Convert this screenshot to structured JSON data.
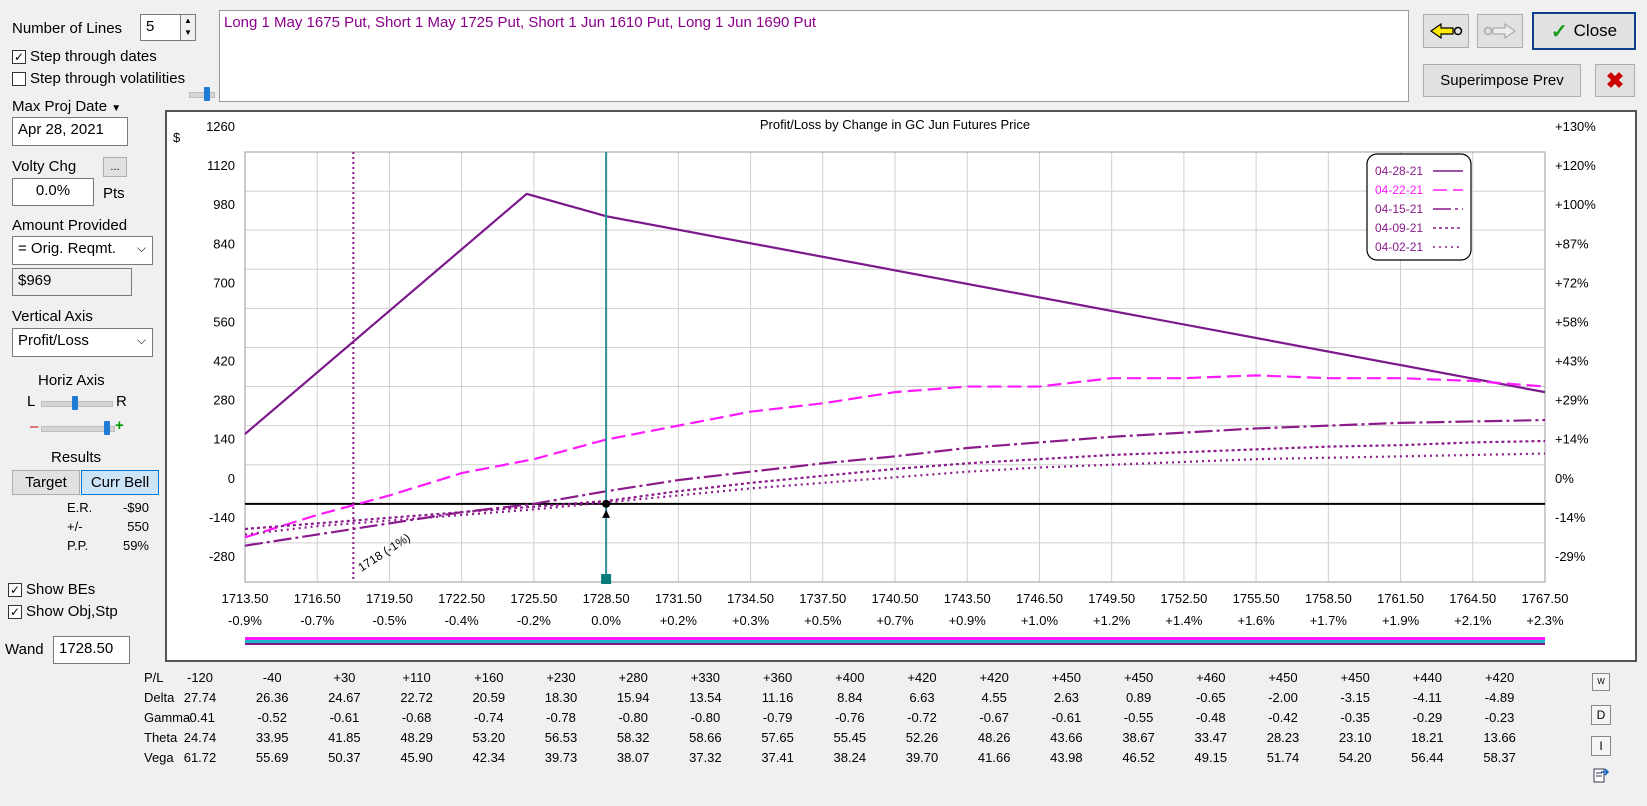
{
  "controls": {
    "number_of_lines_label": "Number of Lines",
    "number_of_lines_value": "5",
    "step_dates_label": "Step through dates",
    "step_dates_checked": true,
    "step_vols_label": "Step through volatilities",
    "step_vols_checked": false,
    "max_proj_date_label": "Max Proj Date",
    "max_proj_date_value": "Apr 28, 2021",
    "volty_chg_label": "Volty Chg",
    "volty_chg_value": "0.0%",
    "volty_unit": "Pts",
    "ellipsis_label": "...",
    "amount_provided_label": "Amount Provided",
    "amount_provided_value": "= Orig. Reqmt.",
    "amount_value": "$969",
    "vertical_axis_label": "Vertical Axis",
    "vertical_axis_value": "Profit/Loss",
    "horiz_axis_label": "Horiz Axis",
    "left_label": "L",
    "right_label": "R",
    "minus_label": "–",
    "plus_label": "+",
    "results_label": "Results",
    "target_button": "Target",
    "curr_bell_button": "Curr Bell",
    "stats": [
      {
        "label": "E.R.",
        "value": "-$90"
      },
      {
        "label": "+/-",
        "value": "550"
      },
      {
        "label": "P.P.",
        "value": "59%"
      }
    ],
    "show_bes_label": "Show BEs",
    "show_bes_checked": true,
    "show_objstp_label": "Show Obj,Stp",
    "show_objstp_checked": true,
    "wand_label": "Wand",
    "wand_value": "1728.50"
  },
  "positions_text": "Long 1 May 1675 Put, Short 1 May 1725 Put, Short 1 Jun 1610 Put, Long 1 Jun 1690 Put",
  "toolbar": {
    "close_label": "Close",
    "superimpose_label": "Superimpose Prev"
  },
  "chart_data": {
    "type": "line",
    "title": "Profit/Loss by Change in GC Jun Futures Price",
    "ylabel": "$",
    "xlim": [
      1713.5,
      1767.5
    ],
    "ylim": [
      -280,
      1260
    ],
    "x_ticks": [
      "1713.50",
      "1716.50",
      "1719.50",
      "1722.50",
      "1725.50",
      "1728.50",
      "1731.50",
      "1734.50",
      "1737.50",
      "1740.50",
      "1743.50",
      "1746.50",
      "1749.50",
      "1752.50",
      "1755.50",
      "1758.50",
      "1761.50",
      "1764.50",
      "1767.50"
    ],
    "x_pct_ticks": [
      "-0.9%",
      "-0.7%",
      "-0.5%",
      "-0.4%",
      "-0.2%",
      "0.0%",
      "+0.2%",
      "+0.3%",
      "+0.5%",
      "+0.7%",
      "+0.9%",
      "+1.0%",
      "+1.2%",
      "+1.4%",
      "+1.6%",
      "+1.7%",
      "+1.9%",
      "+2.1%",
      "+2.3%"
    ],
    "y_ticks": [
      1260,
      1120,
      980,
      840,
      700,
      560,
      420,
      280,
      140,
      0,
      -140,
      -280
    ],
    "y_pct_ticks": [
      "+130%",
      "+120%",
      "+100%",
      "+87%",
      "+72%",
      "+58%",
      "+43%",
      "+29%",
      "+14%",
      "0%",
      "-14%",
      "-29%"
    ],
    "grid": true,
    "legend_position": "top-right",
    "breakeven_x": 1718,
    "breakeven_label": "1718 (-1%)",
    "wand_x": 1728.5,
    "series": [
      {
        "name": "04-28-21",
        "color": "#7b1a8a",
        "dash": "",
        "x": [
          1713.5,
          1725.2,
          1728.5,
          1767.5
        ],
        "y": [
          250,
          1110,
          1030,
          400
        ]
      },
      {
        "name": "04-22-21",
        "color": "#ff19ff",
        "dash": "14 6",
        "x": [
          1713.5,
          1716.5,
          1719.5,
          1722.5,
          1725.5,
          1728.5,
          1731.5,
          1734.5,
          1737.5,
          1740.5,
          1743.5,
          1746.5,
          1749.5,
          1752.5,
          1755.5,
          1758.5,
          1761.5,
          1764.5,
          1767.5
        ],
        "y": [
          -120,
          -40,
          30,
          110,
          160,
          230,
          280,
          330,
          360,
          400,
          420,
          420,
          450,
          450,
          460,
          450,
          450,
          440,
          420
        ]
      },
      {
        "name": "04-15-21",
        "color": "#8b1a8b",
        "dash": "18 4 3 4",
        "x": [
          1713.5,
          1716.5,
          1719.5,
          1722.5,
          1725.5,
          1728.5,
          1731.5,
          1734.5,
          1737.5,
          1740.5,
          1743.5,
          1746.5,
          1749.5,
          1752.5,
          1755.5,
          1758.5,
          1761.5,
          1764.5,
          1767.5
        ],
        "y": [
          -150,
          -110,
          -70,
          -30,
          0,
          45,
          85,
          115,
          145,
          170,
          200,
          220,
          240,
          255,
          270,
          280,
          290,
          295,
          300
        ]
      },
      {
        "name": "04-09-21",
        "color": "#8b1a8b",
        "dash": "3 3",
        "x": [
          1713.5,
          1716.5,
          1719.5,
          1722.5,
          1725.5,
          1728.5,
          1731.5,
          1734.5,
          1737.5,
          1740.5,
          1743.5,
          1746.5,
          1749.5,
          1752.5,
          1755.5,
          1758.5,
          1761.5,
          1764.5,
          1767.5
        ],
        "y": [
          -90,
          -70,
          -50,
          -30,
          -10,
          10,
          45,
          75,
          100,
          125,
          145,
          160,
          175,
          185,
          195,
          205,
          210,
          220,
          225
        ]
      },
      {
        "name": "04-02-21",
        "color": "#8b1a8b",
        "dash": "2 4",
        "x": [
          1713.5,
          1716.5,
          1719.5,
          1722.5,
          1725.5,
          1728.5,
          1731.5,
          1734.5,
          1737.5,
          1740.5,
          1743.5,
          1746.5,
          1749.5,
          1752.5,
          1755.5,
          1758.5,
          1761.5,
          1764.5,
          1767.5
        ],
        "y": [
          -110,
          -80,
          -60,
          -40,
          -20,
          5,
          30,
          55,
          75,
          95,
          115,
          130,
          140,
          150,
          160,
          165,
          170,
          175,
          180
        ]
      }
    ]
  },
  "greeks": {
    "rows": [
      {
        "label": "P/L",
        "values": [
          "-120",
          "-40",
          "+30",
          "+110",
          "+160",
          "+230",
          "+280",
          "+330",
          "+360",
          "+400",
          "+420",
          "+420",
          "+450",
          "+450",
          "+460",
          "+450",
          "+450",
          "+440",
          "+420"
        ]
      },
      {
        "label": "Delta",
        "values": [
          "27.74",
          "26.36",
          "24.67",
          "22.72",
          "20.59",
          "18.30",
          "15.94",
          "13.54",
          "11.16",
          "8.84",
          "6.63",
          "4.55",
          "2.63",
          "0.89",
          "-0.65",
          "-2.00",
          "-3.15",
          "-4.11",
          "-4.89"
        ]
      },
      {
        "label": "Gamma",
        "values": [
          "-0.41",
          "-0.52",
          "-0.61",
          "-0.68",
          "-0.74",
          "-0.78",
          "-0.80",
          "-0.80",
          "-0.79",
          "-0.76",
          "-0.72",
          "-0.67",
          "-0.61",
          "-0.55",
          "-0.48",
          "-0.42",
          "-0.35",
          "-0.29",
          "-0.23"
        ]
      },
      {
        "label": "Theta",
        "values": [
          "24.74",
          "33.95",
          "41.85",
          "48.29",
          "53.20",
          "56.53",
          "58.32",
          "58.66",
          "57.65",
          "55.45",
          "52.26",
          "48.26",
          "43.66",
          "38.67",
          "33.47",
          "28.23",
          "23.10",
          "18.21",
          "13.66"
        ]
      },
      {
        "label": "Vega",
        "values": [
          "61.72",
          "55.69",
          "50.37",
          "45.90",
          "42.34",
          "39.73",
          "38.07",
          "37.32",
          "37.41",
          "38.24",
          "39.70",
          "41.66",
          "43.98",
          "46.52",
          "49.15",
          "51.74",
          "54.20",
          "56.44",
          "58.37"
        ]
      }
    ],
    "side_buttons": [
      "W",
      "D",
      "I"
    ]
  }
}
